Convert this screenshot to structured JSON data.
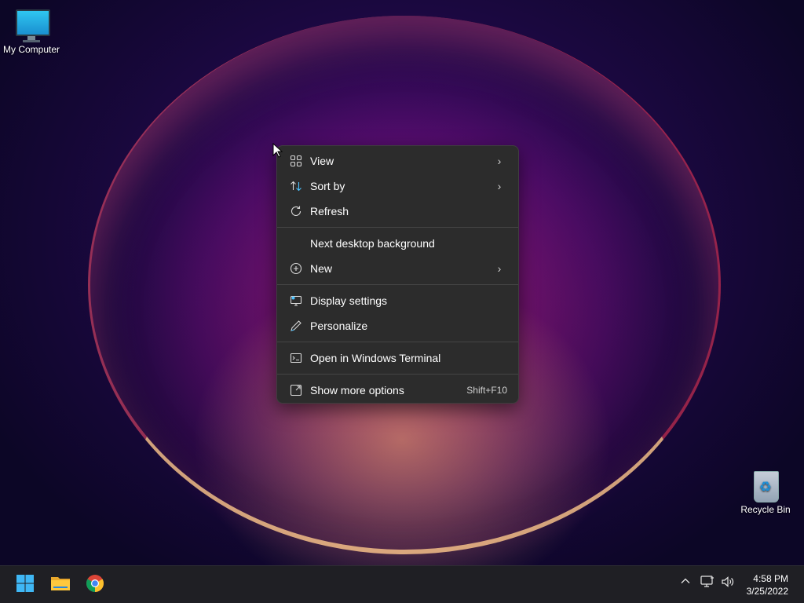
{
  "desktop": {
    "icons": [
      {
        "label": "My Computer",
        "icon": "computer-monitor-icon"
      },
      {
        "label": "Recycle Bin",
        "icon": "recycle-bin-icon"
      }
    ]
  },
  "context_menu": {
    "items": [
      {
        "label": "View",
        "icon": "grid-icon",
        "submenu": true
      },
      {
        "label": "Sort by",
        "icon": "sort-arrows-icon",
        "submenu": true
      },
      {
        "label": "Refresh",
        "icon": "refresh-icon",
        "submenu": false
      },
      {
        "label": "Next desktop background",
        "icon": "",
        "submenu": false
      },
      {
        "label": "New",
        "icon": "plus-circle-icon",
        "submenu": true
      },
      {
        "label": "Display settings",
        "icon": "display-settings-icon",
        "submenu": false
      },
      {
        "label": "Personalize",
        "icon": "pen-icon",
        "submenu": false
      },
      {
        "label": "Open in Windows Terminal",
        "icon": "terminal-icon",
        "submenu": false
      },
      {
        "label": "Show more options",
        "icon": "expand-icon",
        "submenu": false,
        "shortcut": "Shift+F10"
      }
    ]
  },
  "taskbar": {
    "pinned": [
      {
        "name": "Start",
        "icon": "windows-logo-icon"
      },
      {
        "name": "File Explorer",
        "icon": "folder-icon"
      },
      {
        "name": "Google Chrome",
        "icon": "chrome-icon"
      }
    ],
    "tray": {
      "overflow_icon": "chevron-up-icon",
      "network_icon": "network-icon",
      "volume_icon": "volume-icon"
    },
    "clock": {
      "time": "4:58 PM",
      "date": "3/25/2022"
    }
  },
  "colors": {
    "menu_bg": "#2c2c2c",
    "taskbar_bg": "#1f1f24",
    "accent_blue": "#1d8fd8"
  }
}
